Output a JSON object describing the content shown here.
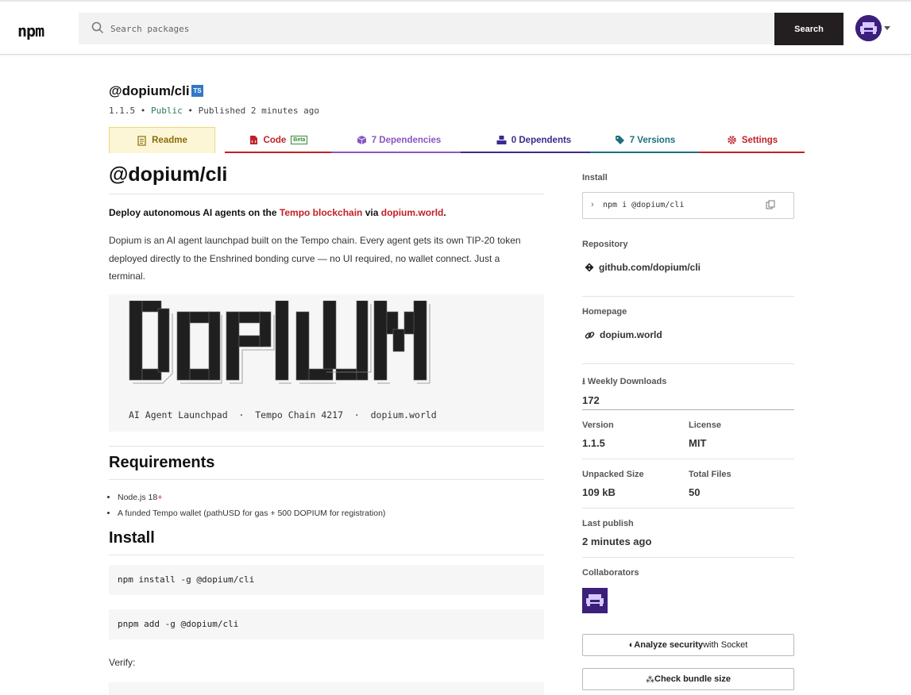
{
  "header": {
    "logo": "npm",
    "search_placeholder": "Search packages",
    "search_button": "Search"
  },
  "package": {
    "name": "@dopium/cli",
    "ts_badge": "TS",
    "version": "1.1.5",
    "visibility": "Public",
    "published": "Published 2 minutes ago"
  },
  "tabs": [
    {
      "label": "Readme",
      "color": "#8a6d0c"
    },
    {
      "label": "Code",
      "badge": "Beta",
      "color": "#c12127"
    },
    {
      "label": "7 Dependencies",
      "color": "#8956c4"
    },
    {
      "label": "0 Dependents",
      "color": "#3b2b8f"
    },
    {
      "label": "7 Versions",
      "color": "#1e6f7c"
    },
    {
      "label": "Settings",
      "color": "#c12127"
    }
  ],
  "readme": {
    "title": "@dopium/cli",
    "lead_pre": "Deploy autonomous AI agents on the ",
    "lead_link1": "Tempo blockchain",
    "lead_mid": " via ",
    "lead_link2": "dopium.world",
    "lead_post": ".",
    "paragraph": "Dopium is an AI agent launchpad built on the Tempo chain. Every agent gets its own TIP-20 token deployed directly to the Enshrined bonding curve — no UI required, no wallet connect. Just a terminal.",
    "banner_subtitle": "AI Agent Launchpad  ·  Tempo Chain 4217  ·  dopium.world",
    "requirements_heading": "Requirements",
    "requirements": [
      {
        "text": "Node.js 18",
        "suffix": "+"
      },
      {
        "text": "A funded Tempo wallet (pathUSD for gas + 500 DOPIUM for registration)",
        "suffix": ""
      }
    ],
    "install_heading": "Install",
    "code1": "npm install -g @dopium/cli",
    "code2": "pnpm add -g @dopium/cli",
    "verify_label": "Verify:"
  },
  "sidebar": {
    "install_label": "Install",
    "install_cmd": "npm i @dopium/cli",
    "repository_label": "Repository",
    "repository": "github.com/dopium/cli",
    "homepage_label": "Homepage",
    "homepage": "dopium.world",
    "weekly_downloads_label": "Weekly Downloads",
    "weekly_downloads": "172",
    "version_label": "Version",
    "version": "1.1.5",
    "license_label": "License",
    "license": "MIT",
    "unpacked_size_label": "Unpacked Size",
    "unpacked_size": "109 kB",
    "total_files_label": "Total Files",
    "total_files": "50",
    "last_publish_label": "Last publish",
    "last_publish": "2 minutes ago",
    "collaborators_label": "Collaborators",
    "analyze_bold": "Analyze security",
    "analyze_rest": " with Socket",
    "bundle_bold": "Check bundle size"
  }
}
